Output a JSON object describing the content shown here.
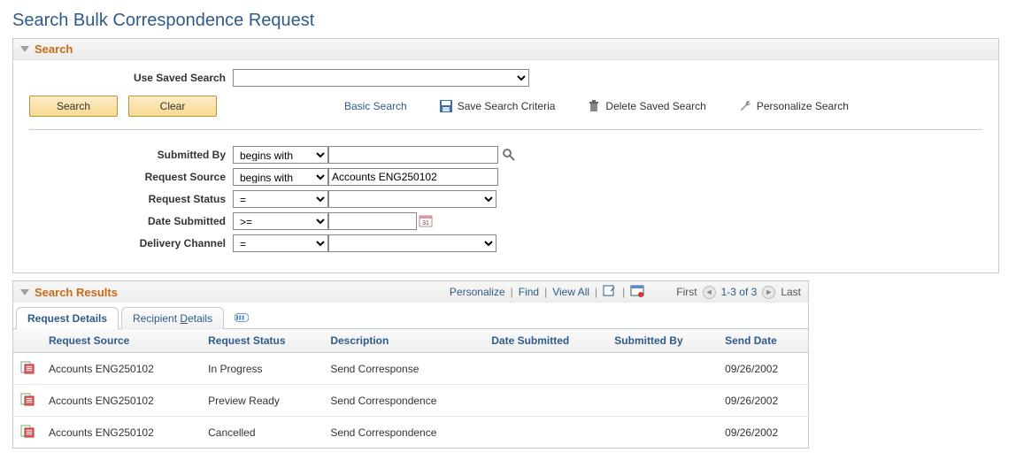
{
  "page_title": "Search Bulk Correspondence Request",
  "search_panel": {
    "title": "Search",
    "saved_search_label": "Use Saved Search",
    "saved_search_value": "",
    "search_button": "Search",
    "clear_button": "Clear",
    "basic_search_link": "Basic Search",
    "save_criteria_link": "Save Search Criteria",
    "delete_saved_link": "Delete Saved Search",
    "personalize_link": "Personalize Search",
    "criteria": {
      "submitted_by": {
        "label": "Submitted By",
        "operator": "begins with",
        "value": ""
      },
      "request_source": {
        "label": "Request Source",
        "operator": "begins with",
        "value": "Accounts ENG250102"
      },
      "request_status": {
        "label": "Request Status",
        "operator": "=",
        "value": ""
      },
      "date_submitted": {
        "label": "Date Submitted",
        "operator": ">=",
        "value": ""
      },
      "delivery_channel": {
        "label": "Delivery Channel",
        "operator": "=",
        "value": ""
      }
    }
  },
  "results": {
    "title": "Search Results",
    "toolbar": {
      "personalize": "Personalize",
      "find": "Find",
      "view_all": "View All",
      "first": "First",
      "range": "1-3 of 3",
      "last": "Last"
    },
    "tabs": {
      "request_details": "Request Details",
      "recipient_details_prefix": "Recipient ",
      "recipient_details_accesskey": "D",
      "recipient_details_suffix": "etails"
    },
    "columns": {
      "request_source": "Request Source",
      "request_status": "Request Status",
      "description": "Description",
      "date_submitted": "Date Submitted",
      "submitted_by": "Submitted By",
      "send_date": "Send Date"
    },
    "rows": [
      {
        "request_source": "Accounts ENG250102",
        "request_status": "In Progress",
        "description": "Send Corresponse",
        "date_submitted": "",
        "submitted_by": "",
        "send_date": "09/26/2002"
      },
      {
        "request_source": "Accounts ENG250102",
        "request_status": "Preview Ready",
        "description": "Send Correspondence",
        "date_submitted": "",
        "submitted_by": "",
        "send_date": "09/26/2002"
      },
      {
        "request_source": "Accounts ENG250102",
        "request_status": "Cancelled",
        "description": "Send Correspondence",
        "date_submitted": "",
        "submitted_by": "",
        "send_date": "09/26/2002"
      }
    ]
  }
}
